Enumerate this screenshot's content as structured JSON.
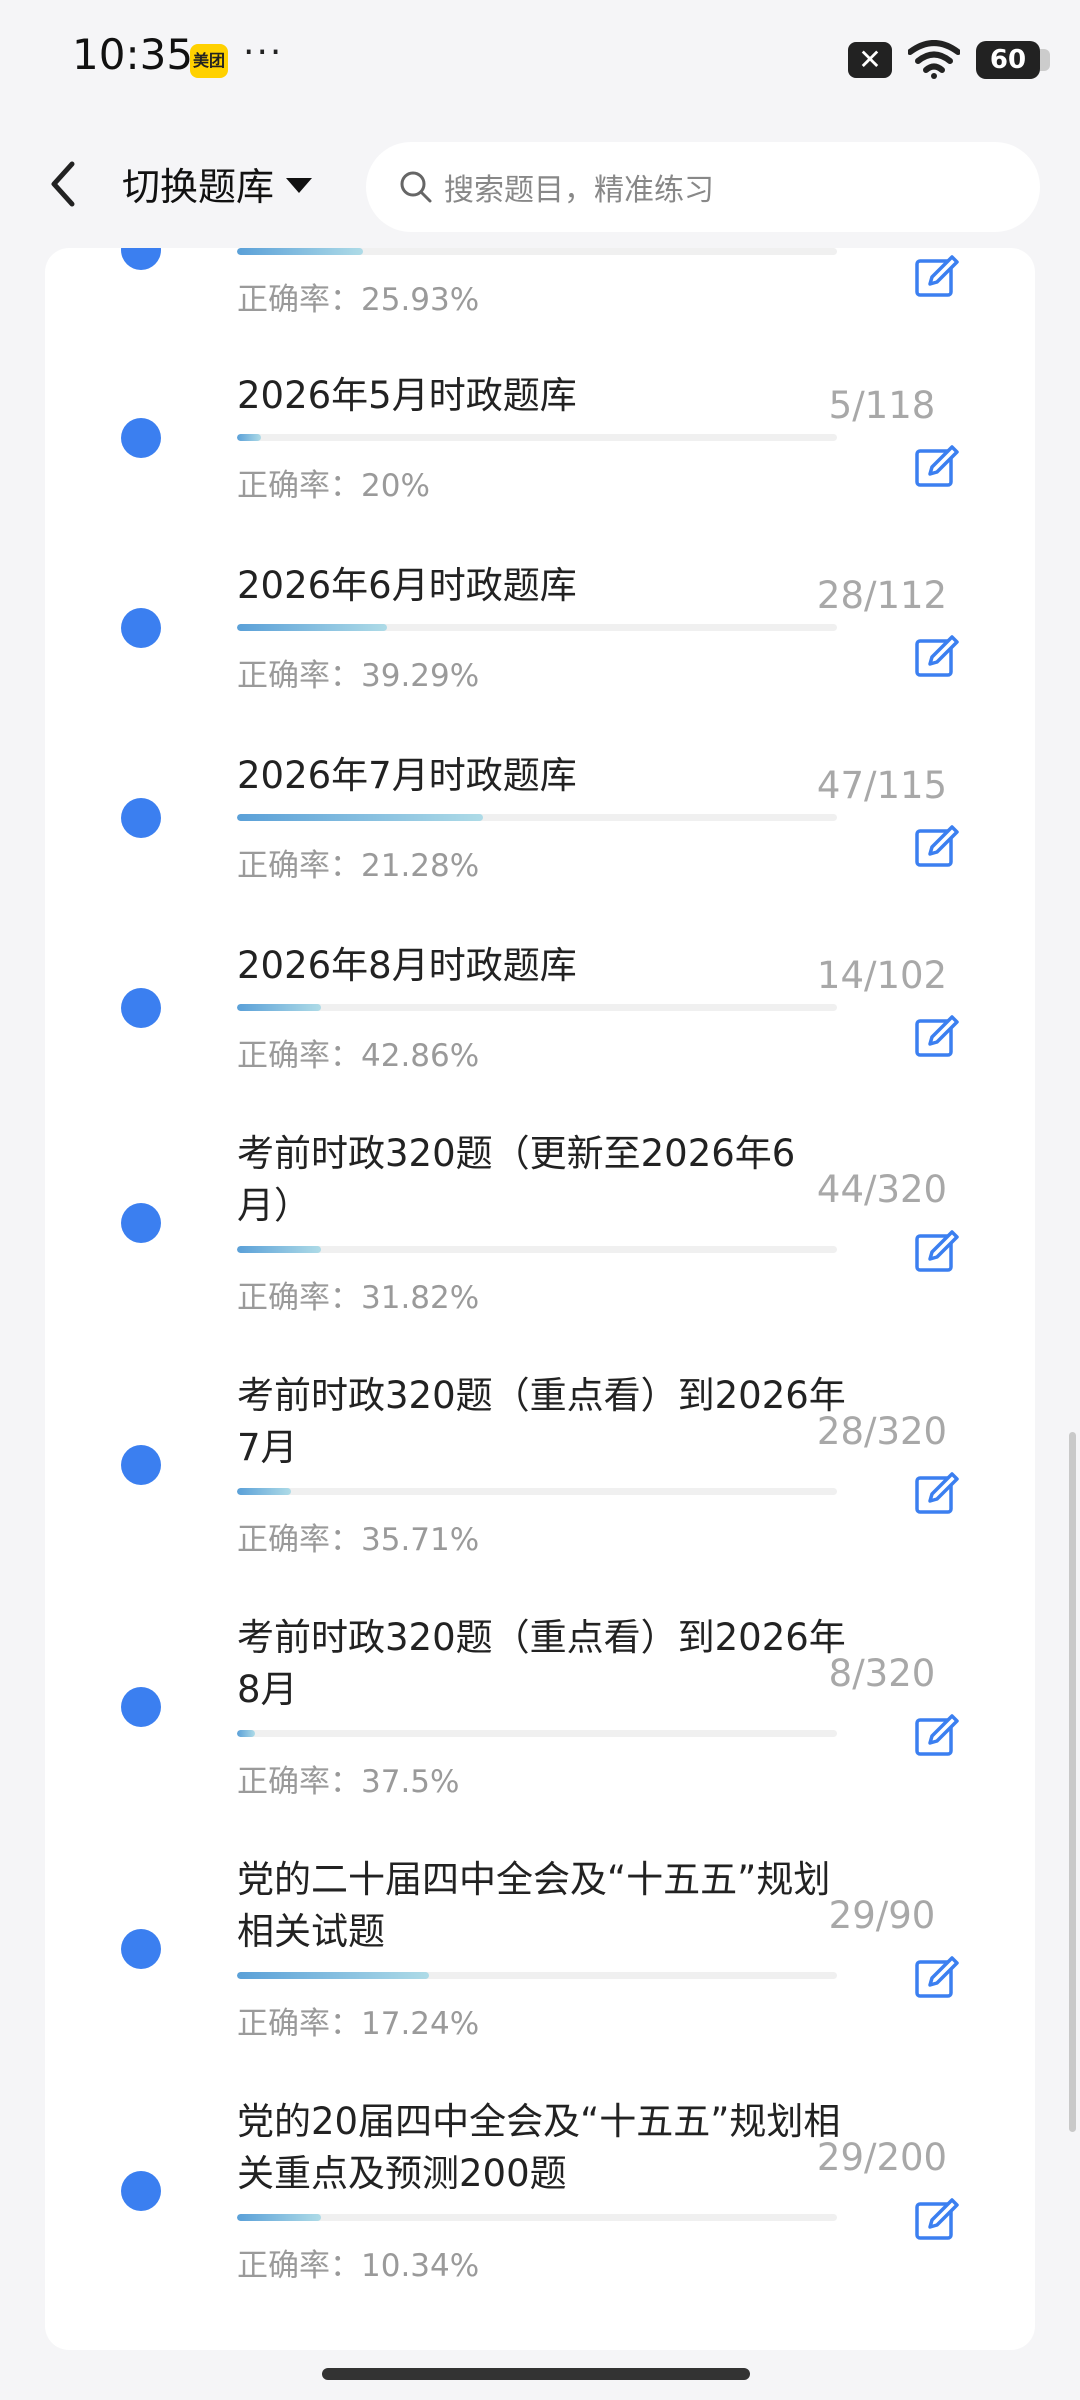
{
  "status_bar": {
    "time": "10:35",
    "app_badge": "美团",
    "more": "···",
    "battery": "60"
  },
  "header": {
    "switch_label": "切换题库",
    "search_placeholder": "搜索题目，精准练习"
  },
  "accuracy_prefix": "正确率：",
  "items": [
    {
      "title": "",
      "accuracy": "25.93%",
      "count": "",
      "progress": 0.21
    },
    {
      "title": "2026年5月时政题库",
      "accuracy": "20%",
      "count": "5/118",
      "progress": 0.04
    },
    {
      "title": "2026年6月时政题库",
      "accuracy": "39.29%",
      "count": "28/112",
      "progress": 0.25
    },
    {
      "title": "2026年7月时政题库",
      "accuracy": "21.28%",
      "count": "47/115",
      "progress": 0.41
    },
    {
      "title": "2026年8月时政题库",
      "accuracy": "42.86%",
      "count": "14/102",
      "progress": 0.14
    },
    {
      "title": "考前时政320题（更新至2026年6月）",
      "accuracy": "31.82%",
      "count": "44/320",
      "progress": 0.14
    },
    {
      "title": "考前时政320题（重点看）到2026年7月",
      "accuracy": "35.71%",
      "count": "28/320",
      "progress": 0.09
    },
    {
      "title": "考前时政320题（重点看）到2026年8月",
      "accuracy": "37.5%",
      "count": "8/320",
      "progress": 0.03
    },
    {
      "title": "党的二十届四中全会及“十五五”规划相关试题",
      "accuracy": "17.24%",
      "count": "29/90",
      "progress": 0.32
    },
    {
      "title": "党的20届四中全会及“十五五”规划相关重点及预测200题",
      "accuracy": "10.34%",
      "count": "29/200",
      "progress": 0.14
    }
  ]
}
